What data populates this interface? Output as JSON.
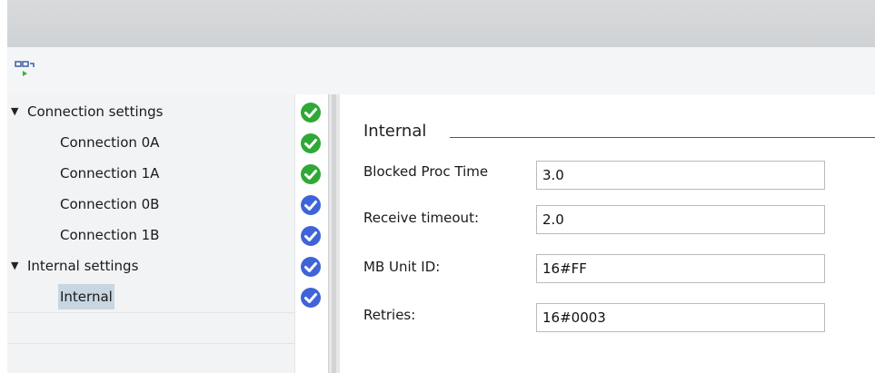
{
  "tree": {
    "items": [
      {
        "label": "Connection settings",
        "level": 0,
        "expanded": true,
        "status": "green"
      },
      {
        "label": "Connection 0A",
        "level": 1,
        "status": "green"
      },
      {
        "label": "Connection 1A",
        "level": 1,
        "status": "green"
      },
      {
        "label": "Connection 0B",
        "level": 1,
        "status": "blue"
      },
      {
        "label": "Connection 1B",
        "level": 1,
        "status": "blue"
      },
      {
        "label": "Internal settings",
        "level": 0,
        "expanded": true,
        "status": "blue"
      },
      {
        "label": "Internal",
        "level": 1,
        "selected": true,
        "status": "blue"
      }
    ]
  },
  "status_colors": {
    "green": "#2fa835",
    "blue": "#3f64d8"
  },
  "section": {
    "title": "Internal",
    "fields": [
      {
        "label": "Blocked Proc Time",
        "value": "3.0"
      },
      {
        "label": "Receive timeout:",
        "value": "2.0"
      },
      {
        "label": "MB Unit ID:",
        "value": "16#FF"
      },
      {
        "label": "Retries:",
        "value": "16#0003"
      }
    ]
  },
  "toolbar": {
    "icon": "network-view-icon"
  }
}
